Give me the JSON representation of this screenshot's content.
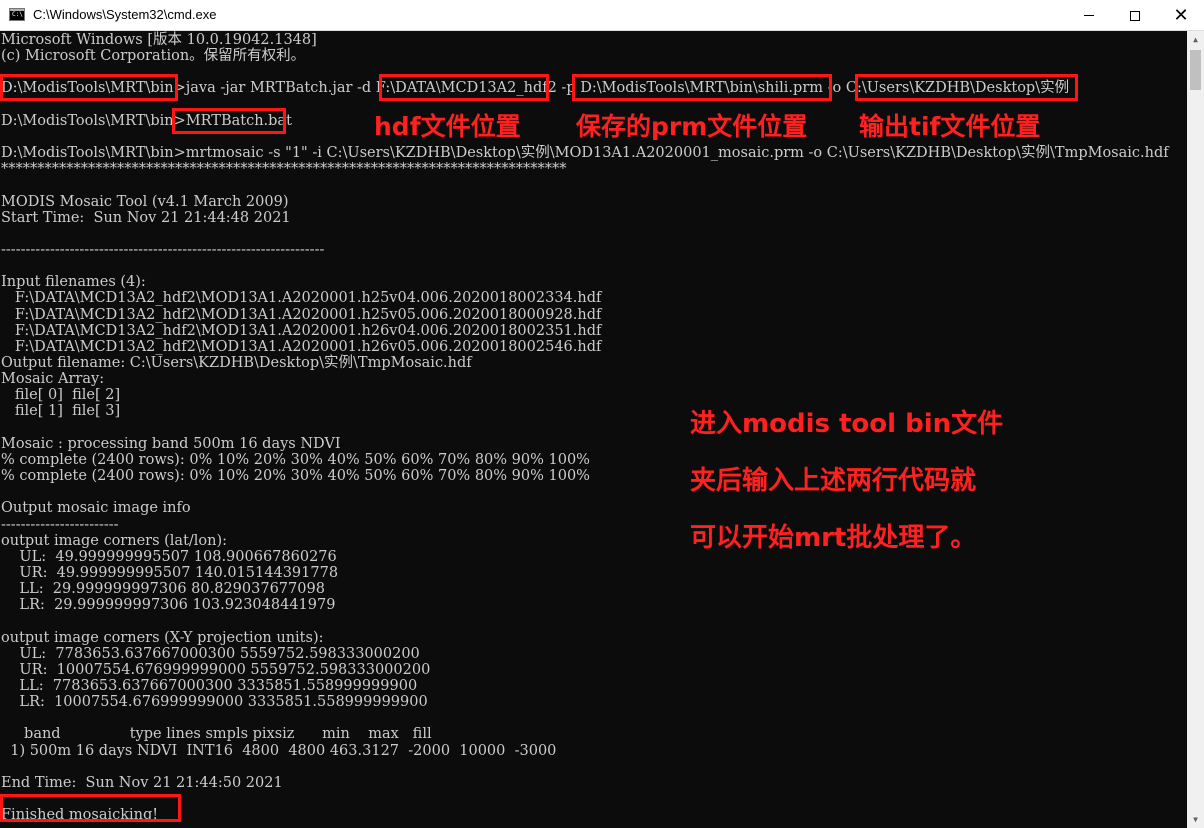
{
  "window": {
    "title": "C:\\Windows\\System32\\cmd.exe",
    "icon": "cmd-icon",
    "controls": [
      "minimize-icon",
      "maximize-icon",
      "close-icon"
    ]
  },
  "console": {
    "lines": [
      "Microsoft Windows [版本 10.0.19042.1348]",
      "(c) Microsoft Corporation。保留所有权利。",
      "",
      "D:\\ModisTools\\MRT\\bin>java -jar MRTBatch.jar -d F:\\DATA\\MCD13A2_hdf2 -p D:\\ModisTools\\MRT\\bin\\shili.prm -o C:\\Users\\KZDHB\\Desktop\\实例",
      "",
      "D:\\ModisTools\\MRT\\bin>MRTBatch.bat",
      "",
      "D:\\ModisTools\\MRT\\bin>mrtmosaic -s \"1\" -i C:\\Users\\KZDHB\\Desktop\\实例\\MOD13A1.A2020001_mosaic.prm -o C:\\Users\\KZDHB\\Desktop\\实例\\TmpMosaic.hdf",
      "******************************************************************************",
      "",
      "MODIS Mosaic Tool (v4.1 March 2009)",
      "Start Time:  Sun Nov 21 21:44:48 2021",
      "",
      "------------------------------------------------------------------",
      "",
      "Input filenames (4):",
      "   F:\\DATA\\MCD13A2_hdf2\\MOD13A1.A2020001.h25v04.006.2020018002334.hdf",
      "   F:\\DATA\\MCD13A2_hdf2\\MOD13A1.A2020001.h25v05.006.2020018000928.hdf",
      "   F:\\DATA\\MCD13A2_hdf2\\MOD13A1.A2020001.h26v04.006.2020018002351.hdf",
      "   F:\\DATA\\MCD13A2_hdf2\\MOD13A1.A2020001.h26v05.006.2020018002546.hdf",
      "Output filename: C:\\Users\\KZDHB\\Desktop\\实例\\TmpMosaic.hdf",
      "Mosaic Array:",
      "   file[ 0]  file[ 2]",
      "   file[ 1]  file[ 3]",
      "",
      "Mosaic : processing band 500m 16 days NDVI",
      "% complete (2400 rows): 0% 10% 20% 30% 40% 50% 60% 70% 80% 90% 100%",
      "% complete (2400 rows): 0% 10% 20% 30% 40% 50% 60% 70% 80% 90% 100%",
      "",
      "Output mosaic image info",
      "------------------------",
      "output image corners (lat/lon):",
      "    UL:  49.999999995507 108.900667860276",
      "    UR:  49.999999995507 140.015144391778",
      "    LL:  29.999999997306 80.829037677098",
      "    LR:  29.999999997306 103.923048441979",
      "",
      "output image corners (X-Y projection units):",
      "    UL:  7783653.637667000300 5559752.598333000200",
      "    UR:  10007554.676999999000 5559752.598333000200",
      "    LL:  7783653.637667000300 3335851.558999999900",
      "    LR:  10007554.676999999000 3335851.558999999900",
      "",
      "     band               type lines smpls pixsiz      min    max   fill",
      "  1) 500m 16 days NDVI  INT16  4800  4800 463.3127  -2000  10000  -3000",
      "",
      "End Time:  Sun Nov 21 21:44:50 2021",
      "",
      "Finished mosaicking!"
    ]
  },
  "annotations": {
    "hdf_location": "hdf文件位置",
    "prm_location": "保存的prm文件位置",
    "tif_location": "输出tif文件位置",
    "instruction": "进入modis tool bin文件\n夹后输入上述两行代码就\n可以开始mrt批处理了。",
    "color": "#ff1515"
  },
  "colors": {
    "console_bg": "#0c0c0c",
    "console_text": "#cccccc",
    "titlebar_bg": "#ffffff"
  }
}
